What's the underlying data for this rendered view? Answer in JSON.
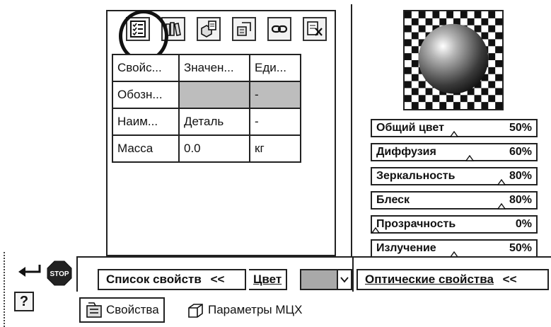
{
  "properties_table": {
    "headers": [
      "Свойс...",
      "Значен...",
      "Еди..."
    ],
    "rows": [
      [
        "Обозн...",
        "",
        "-"
      ],
      [
        "Наим...",
        "Деталь",
        "-"
      ],
      [
        "Масса",
        "0.0",
        "кг"
      ]
    ]
  },
  "toolbar": {
    "buttons": [
      "properties-list-icon",
      "library-icon",
      "components-icon",
      "objects-icon",
      "link-icon",
      "delete-icon"
    ]
  },
  "optics": {
    "sliders": [
      {
        "label": "Общий цвет",
        "value": "50%",
        "level": 50
      },
      {
        "label": "Диффузия",
        "value": "60%",
        "level": 60
      },
      {
        "label": "Зеркальность",
        "value": "80%",
        "level": 80
      },
      {
        "label": "Блеск",
        "value": "80%",
        "level": 80
      },
      {
        "label": "Прозрачность",
        "value": "0%",
        "level": 0
      },
      {
        "label": "Излучение",
        "value": "50%",
        "level": 50
      }
    ]
  },
  "bottom_bar": {
    "props_list_label": "Список свойств",
    "props_list_chevron": "<<",
    "color_label": "Цвет",
    "color_value": "#a9a9a9",
    "optics_label": "Оптические свойства",
    "optics_chevron": "<<"
  },
  "tabs": {
    "properties": "Свойства",
    "mch_params": "Параметры МЦХ"
  },
  "stop_label": "STOP",
  "help_label": "?"
}
